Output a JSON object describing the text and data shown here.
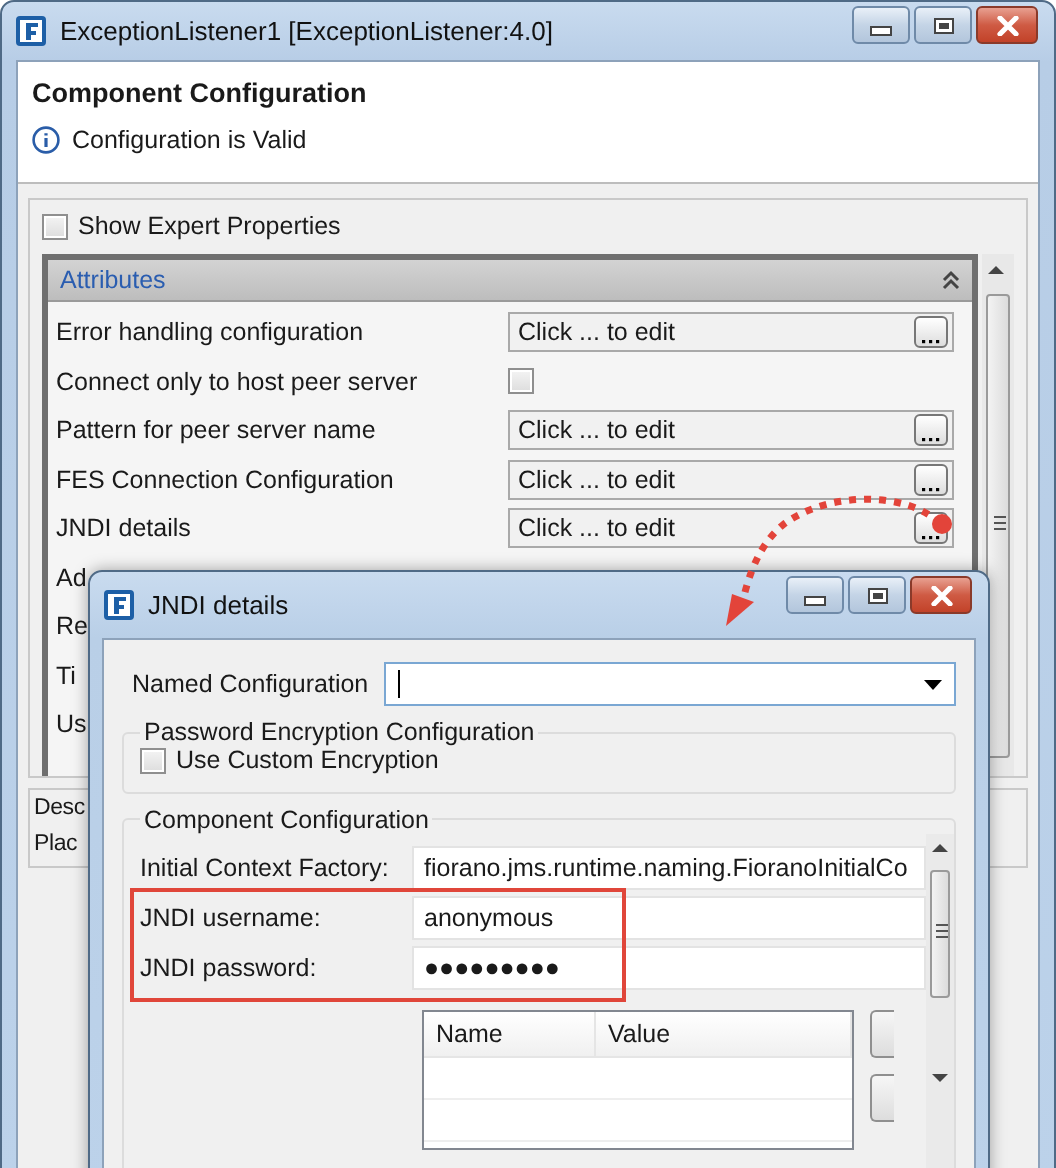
{
  "window": {
    "title": "ExceptionListener1 [ExceptionListener:4.0]"
  },
  "header": {
    "title": "Component Configuration",
    "message": "Configuration is Valid"
  },
  "show_expert_properties": {
    "label": "Show Expert Properties",
    "checked": false
  },
  "attributes": {
    "title": "Attributes",
    "expanded": true,
    "rows": [
      {
        "label": "Error handling configuration",
        "kind": "editor",
        "value": "Click ... to edit"
      },
      {
        "label": "Connect only to host peer server",
        "kind": "checkbox",
        "checked": false
      },
      {
        "label": "Pattern for peer server name",
        "kind": "editor",
        "value": "Click ... to edit"
      },
      {
        "label": "FES Connection Configuration",
        "kind": "editor",
        "value": "Click ... to edit"
      },
      {
        "label": "JNDI details",
        "kind": "editor",
        "value": "Click ... to edit"
      },
      {
        "label": "Ad",
        "kind": "covered"
      },
      {
        "label": "Re",
        "kind": "covered"
      },
      {
        "label": "Ti",
        "kind": "covered"
      },
      {
        "label": "Us",
        "kind": "covered"
      }
    ]
  },
  "description": {
    "labels": [
      "Desc",
      "Plac"
    ]
  },
  "dialog": {
    "title": "JNDI details",
    "named_configuration": {
      "label": "Named Configuration"
    },
    "password_group": {
      "title": "Password Encryption Configuration",
      "option": {
        "label": "Use Custom Encryption",
        "checked": false
      }
    },
    "component_group": {
      "title": "Component Configuration",
      "fields": [
        {
          "label": "Initial Context Factory:",
          "value": "fiorano.jms.runtime.naming.FioranoInitialCo",
          "highlighted": false
        },
        {
          "label": "JNDI username:",
          "value": "anonymous",
          "highlighted": true
        },
        {
          "label": "JNDI password:",
          "value": "●●●●●●●●●",
          "highlighted": true
        }
      ],
      "table": {
        "columns": [
          "Name",
          "Value"
        ]
      }
    }
  }
}
